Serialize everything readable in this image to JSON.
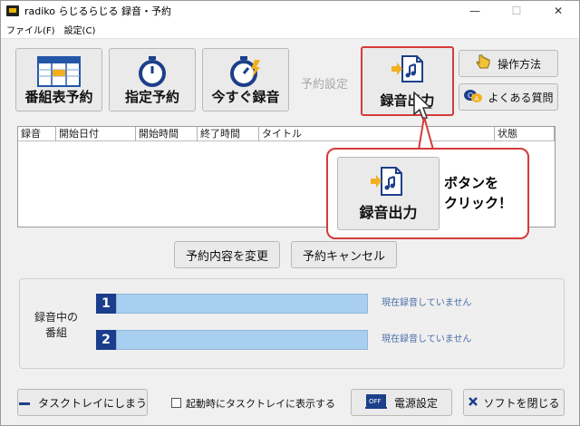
{
  "window": {
    "title": "radiko らじるらじる 録音・予約",
    "minimize": "—",
    "maximize": "☐",
    "close": "✕"
  },
  "menu": {
    "file": "ファイル(F)",
    "settings": "設定(C)"
  },
  "toolbar": {
    "schedule_reserve": "番組表予約",
    "specified_reserve": "指定予約",
    "record_now": "今すぐ録音",
    "reserve_settings": "予約設定",
    "record_output": "録音出力",
    "how_to_use": "操作方法",
    "faq": "よくある質問"
  },
  "list": {
    "columns": [
      "録音",
      "開始日付",
      "開始時間",
      "終了時間",
      "タイトル",
      "状態"
    ]
  },
  "callout": {
    "button_label": "録音出力",
    "text": "ボタンを\nクリック！"
  },
  "actions": {
    "change": "予約内容を変更",
    "cancel": "予約キャンセル"
  },
  "recording": {
    "label": "録音中の\n番組",
    "slots": [
      {
        "num": "1",
        "status": "現在録音していません"
      },
      {
        "num": "2",
        "status": "現在録音していません"
      }
    ]
  },
  "bottom": {
    "tray": "タスクトレイにしまう",
    "startup_checkbox": "起動時にタスクトレイに表示する",
    "power": "電源設定",
    "close_app": "ソフトを閉じる",
    "power_icon_text": "OFF"
  },
  "colors": {
    "accent_red": "#d63a3a",
    "slot_blue": "#1a3e8c",
    "bar_fill": "#a9cff0"
  }
}
